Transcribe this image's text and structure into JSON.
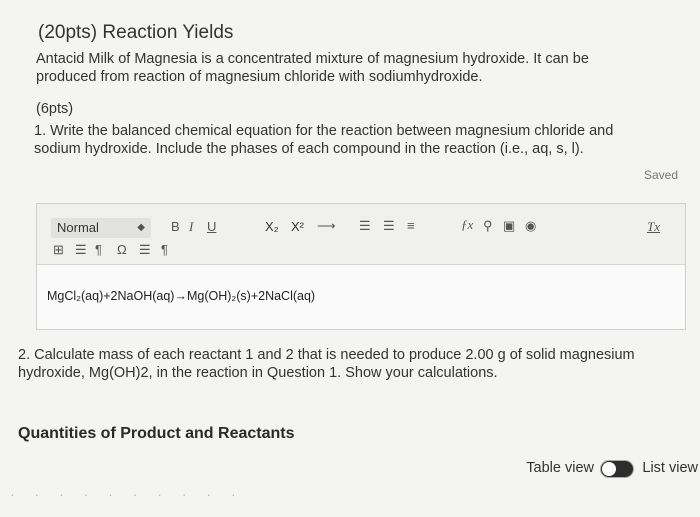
{
  "header": {
    "title": "(20pts) Reaction Yields",
    "intro": "Antacid Milk of Magnesia is a concentrated mixture of magnesium hydroxide. It can be produced from reaction of magnesium chloride with sodiumhydroxide.",
    "points": "(6pts)"
  },
  "question1": {
    "text": "1. Write the balanced chemical equation for the reaction between magnesium chloride and sodium hydroxide. Include the phases of each compound in the reaction (i.e., aq, s, l).",
    "status": "Saved"
  },
  "editor": {
    "format_value": "Normal",
    "bold_label": "B",
    "italic_label": "I",
    "underline_label": "U",
    "subscript_label": "X₂",
    "superscript_label": "X²",
    "arrow_label": "⟶",
    "clear_label": "Tx",
    "answer": "MgCl₂(aq)+2NaOH(aq)→Mg(OH)₂(s)+2NaCl(aq)"
  },
  "question2": {
    "text": "2. Calculate mass of each reactant 1 and 2 that is needed to produce 2.00 g of solid magnesium hydroxide, Mg(OH)2, in the reaction in Question 1. Show your calculations."
  },
  "section": {
    "title": "Quantities of Product and Reactants"
  },
  "view_toggle": {
    "table_label": "Table view",
    "list_label": "List view"
  }
}
